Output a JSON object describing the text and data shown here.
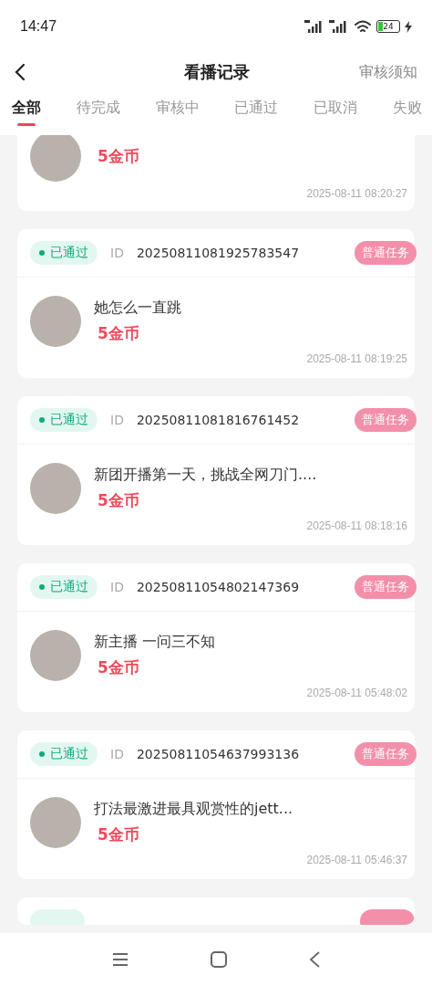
{
  "status_bar": {
    "time": "14:47",
    "battery": "24"
  },
  "header": {
    "title": "看播记录",
    "action": "审核须知"
  },
  "tabs": [
    {
      "label": "全部",
      "selected": true
    },
    {
      "label": "待完成",
      "selected": false
    },
    {
      "label": "审核中",
      "selected": false
    },
    {
      "label": "已通过",
      "selected": false
    },
    {
      "label": "已取消",
      "selected": false
    },
    {
      "label": "失败",
      "selected": false
    }
  ],
  "records": [
    {
      "kind": "cut_top",
      "reward": "5金币",
      "time": "2025-08-11 08:20:27"
    },
    {
      "kind": "full",
      "status": "已通过",
      "id_label": "ID",
      "id": "20250811081925783547",
      "tag": "普通任务",
      "title": "她怎么一直跳",
      "reward": "5金币",
      "time": "2025-08-11 08:19:25"
    },
    {
      "kind": "full",
      "status": "已通过",
      "id_label": "ID",
      "id": "20250811081816761452",
      "tag": "普通任务",
      "title": "新团开播第一天，挑战全网刀门....",
      "reward": "5金币",
      "time": "2025-08-11 08:18:16"
    },
    {
      "kind": "full",
      "status": "已通过",
      "id_label": "ID",
      "id": "20250811054802147369",
      "tag": "普通任务",
      "title": "新主播 一问三不知",
      "reward": "5金币",
      "time": "2025-08-11 05:48:02"
    },
    {
      "kind": "full",
      "status": "已通过",
      "id_label": "ID",
      "id": "20250811054637993136",
      "tag": "普通任务",
      "title": "打法最激进最具观赏性的jett...",
      "reward": "5金币",
      "time": "2025-08-11 05:46:37"
    },
    {
      "kind": "cut_bottom"
    }
  ]
}
